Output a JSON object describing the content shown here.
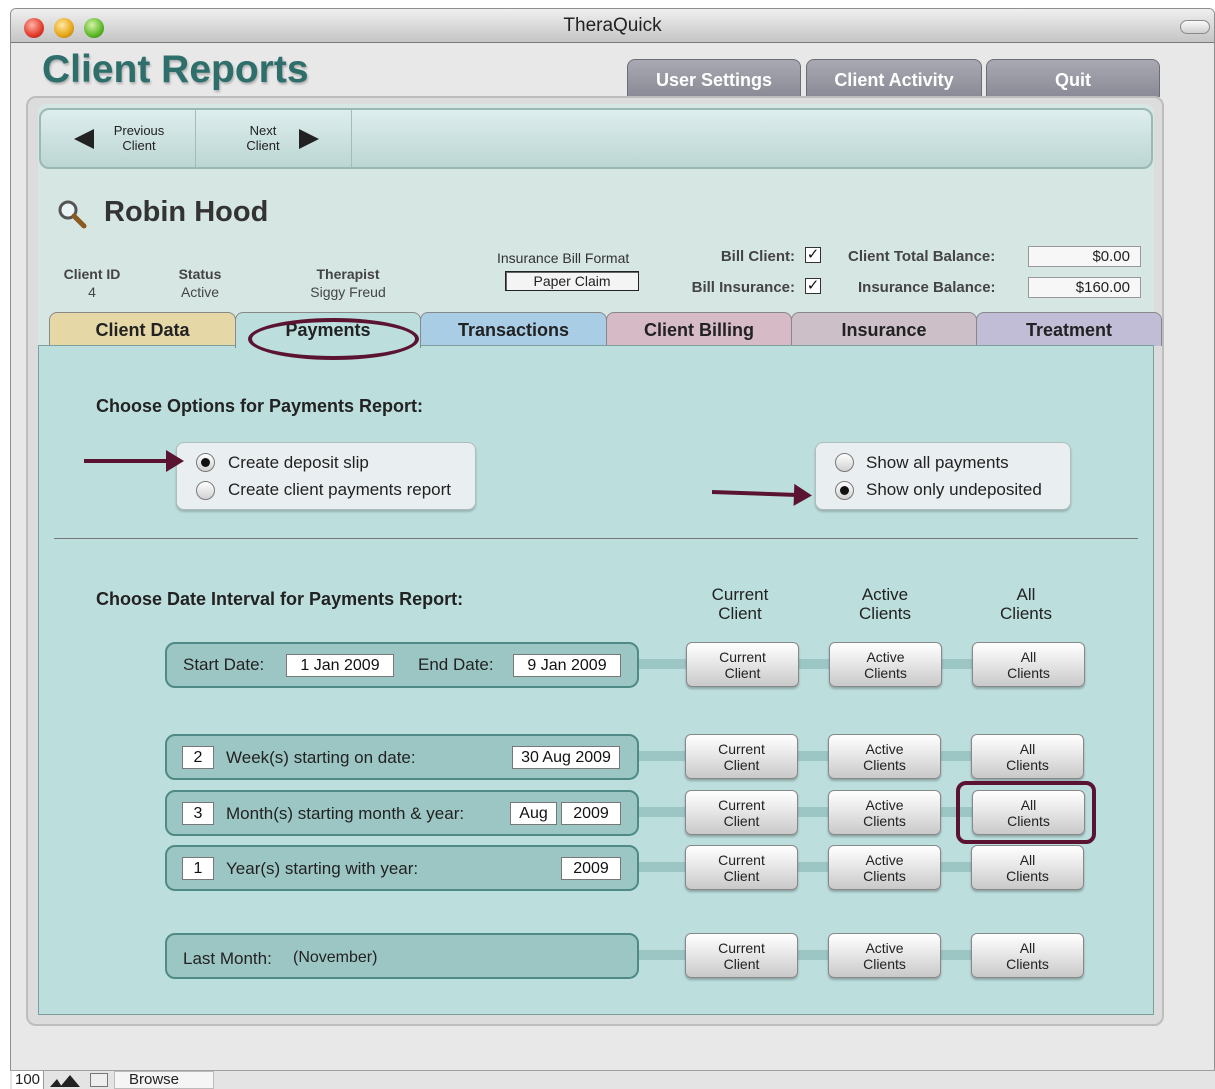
{
  "window": {
    "title": "TheraQuick"
  },
  "app": {
    "title": "Client Reports"
  },
  "top_tabs": [
    {
      "label": "User Settings"
    },
    {
      "label": "Client Activity"
    },
    {
      "label": "Quit"
    }
  ],
  "nav": {
    "previous": {
      "line1": "Previous",
      "line2": "Client"
    },
    "next": {
      "line1": "Next",
      "line2": "Client"
    }
  },
  "client": {
    "name": "Robin Hood",
    "id_label": "Client ID",
    "id_value": "4",
    "status_label": "Status",
    "status_value": "Active",
    "therapist_label": "Therapist",
    "therapist_value": "Siggy Freud",
    "format_label": "Insurance Bill Format",
    "format_value": "Paper Claim",
    "bill_client_label": "Bill Client:",
    "bill_client_checked": true,
    "bill_insurance_label": "Bill Insurance:",
    "bill_insurance_checked": true,
    "total_balance_label": "Client Total Balance:",
    "total_balance_value": "$0.00",
    "insurance_balance_label": "Insurance Balance:",
    "insurance_balance_value": "$160.00"
  },
  "tabs": [
    {
      "label": "Client Data",
      "color": "#e6d8a6"
    },
    {
      "label": "Payments",
      "color": "#bcdedd",
      "active": true
    },
    {
      "label": "Transactions",
      "color": "#a9cde5"
    },
    {
      "label": "Client Billing",
      "color": "#d6bac6"
    },
    {
      "label": "Insurance",
      "color": "#ccbfc8"
    },
    {
      "label": "Treatment",
      "color": "#c2bdd7"
    }
  ],
  "options": {
    "title": "Choose Options for Payments Report:",
    "report_type": [
      {
        "label": "Create deposit slip",
        "selected": true
      },
      {
        "label": "Create client payments report",
        "selected": false
      }
    ],
    "show": [
      {
        "label": "Show all payments",
        "selected": false
      },
      {
        "label": "Show only undeposited",
        "selected": true
      }
    ]
  },
  "interval": {
    "title": "Choose Date Interval for Payments Report:",
    "columns": [
      {
        "line1": "Current",
        "line2": "Client"
      },
      {
        "line1": "Active",
        "line2": "Clients"
      },
      {
        "line1": "All",
        "line2": "Clients"
      }
    ],
    "start_label": "Start Date:",
    "start_value": "1 Jan 2009",
    "end_label": "End Date:",
    "end_value": "9 Jan 2009",
    "weeks_count": "2",
    "weeks_label": "Week(s) starting on date:",
    "weeks_date": "30 Aug 2009",
    "months_count": "3",
    "months_label": "Month(s) starting month & year:",
    "months_month": "Aug",
    "months_year": "2009",
    "years_count": "1",
    "years_label": "Year(s) starting with year:",
    "years_year": "2009",
    "last_month_label": "Last Month:",
    "last_month_value": "(November)",
    "buttons": {
      "current": {
        "line1": "Current",
        "line2": "Client"
      },
      "active": {
        "line1": "Active",
        "line2": "Clients"
      },
      "all": {
        "line1": "All",
        "line2": "Clients"
      }
    }
  },
  "status": {
    "zoom": "100",
    "mode": "Browse"
  },
  "colors": {
    "annotation": "#5b1332",
    "accent_title": "#2e6f6b",
    "panel": "#bcdedd"
  }
}
